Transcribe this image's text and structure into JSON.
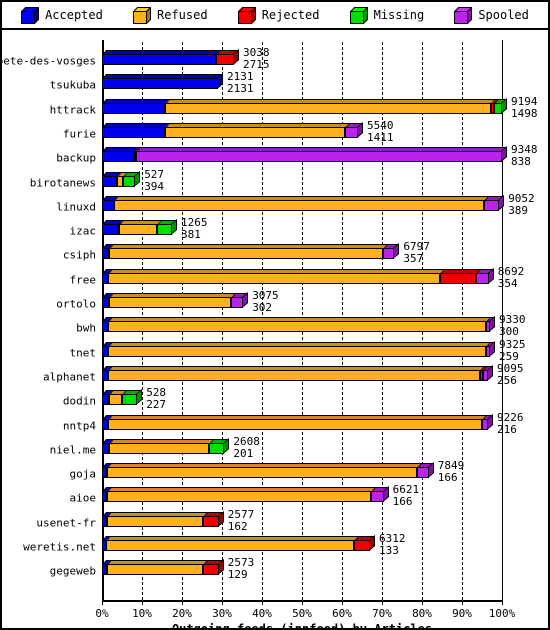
{
  "legend": {
    "items": [
      {
        "label": "Accepted",
        "color": "#0000ee",
        "icon": "cube-icon"
      },
      {
        "label": "Refused",
        "color": "#ffb020",
        "icon": "cube-icon"
      },
      {
        "label": "Rejected",
        "color": "#ee0000",
        "icon": "cube-icon"
      },
      {
        "label": "Missing",
        "color": "#00dd00",
        "icon": "cube-icon"
      },
      {
        "label": "Spooled",
        "color": "#bb22ee",
        "icon": "cube-icon"
      }
    ]
  },
  "chart_data": {
    "type": "bar",
    "orientation": "horizontal",
    "stacked": true,
    "title": "Outgoing feeds (innfeed) by Articles",
    "xlabel": "Outgoing feeds (innfeed) by Articles",
    "ylabel": "",
    "xlim": [
      0,
      100
    ],
    "xunit": "%",
    "grid": true,
    "legend_position": "top",
    "xticks": [
      "0%",
      "10%",
      "20%",
      "30%",
      "40%",
      "50%",
      "60%",
      "70%",
      "80%",
      "90%",
      "100%"
    ],
    "xtick_values": [
      0,
      10,
      20,
      30,
      40,
      50,
      60,
      70,
      80,
      90,
      100
    ],
    "series_names": [
      "Accepted",
      "Refused",
      "Rejected",
      "Missing",
      "Spooled"
    ],
    "series_colors": [
      "#0000ee",
      "#ffb020",
      "#ee0000",
      "#00dd00",
      "#bb22ee"
    ],
    "categories": [
      "bete-des-vosges",
      "tsukuba",
      "httrack",
      "furie",
      "backup",
      "birotanews",
      "linuxd",
      "izac",
      "csiph",
      "free",
      "ortolo",
      "bwh",
      "tnet",
      "alphanet",
      "dodin",
      "nntp4",
      "niel.me",
      "goja",
      "aioe",
      "usenet-fr",
      "weretis.net",
      "gegeweb"
    ],
    "rows": [
      {
        "name": "bete-des-vosges",
        "label_top": "3038",
        "label_bottom": "2715",
        "segments": [
          {
            "series": "Accepted",
            "pct": 28.5
          },
          {
            "series": "Rejected",
            "pct": 4.5
          }
        ]
      },
      {
        "name": "tsukuba",
        "label_top": "2131",
        "label_bottom": "2131",
        "segments": [
          {
            "series": "Accepted",
            "pct": 29.0
          }
        ]
      },
      {
        "name": "httrack",
        "label_top": "9194",
        "label_bottom": "1498",
        "segments": [
          {
            "series": "Accepted",
            "pct": 15.8
          },
          {
            "series": "Refused",
            "pct": 81.5
          },
          {
            "series": "Rejected",
            "pct": 0.8
          },
          {
            "series": "Missing",
            "pct": 1.9
          }
        ]
      },
      {
        "name": "furie",
        "label_top": "5540",
        "label_bottom": "1411",
        "segments": [
          {
            "series": "Accepted",
            "pct": 15.8
          },
          {
            "series": "Refused",
            "pct": 45.0
          },
          {
            "series": "Spooled",
            "pct": 3.2
          }
        ]
      },
      {
        "name": "backup",
        "label_top": "9348",
        "label_bottom": "838",
        "segments": [
          {
            "series": "Accepted",
            "pct": 8.0
          },
          {
            "series": "Rejected",
            "pct": 0.5
          },
          {
            "series": "Spooled",
            "pct": 91.5
          }
        ]
      },
      {
        "name": "birotanews",
        "label_top": "527",
        "label_bottom": "394",
        "segments": [
          {
            "series": "Accepted",
            "pct": 3.8
          },
          {
            "series": "Refused",
            "pct": 1.5
          },
          {
            "series": "Missing",
            "pct": 3.0
          }
        ]
      },
      {
        "name": "linuxd",
        "label_top": "9052",
        "label_bottom": "389",
        "segments": [
          {
            "series": "Accepted",
            "pct": 3.0
          },
          {
            "series": "Refused",
            "pct": 92.5
          },
          {
            "series": "Spooled",
            "pct": 3.8
          }
        ]
      },
      {
        "name": "izac",
        "label_top": "1265",
        "label_bottom": "381",
        "segments": [
          {
            "series": "Accepted",
            "pct": 4.2
          },
          {
            "series": "Refused",
            "pct": 9.5
          },
          {
            "series": "Missing",
            "pct": 3.8
          }
        ]
      },
      {
        "name": "csiph",
        "label_top": "6797",
        "label_bottom": "357",
        "segments": [
          {
            "series": "Accepted",
            "pct": 1.8
          },
          {
            "series": "Refused",
            "pct": 68.5
          },
          {
            "series": "Spooled",
            "pct": 2.8
          }
        ]
      },
      {
        "name": "free",
        "label_top": "8692",
        "label_bottom": "354",
        "segments": [
          {
            "series": "Accepted",
            "pct": 1.5
          },
          {
            "series": "Refused",
            "pct": 83.0
          },
          {
            "series": "Rejected",
            "pct": 9.0
          },
          {
            "series": "Spooled",
            "pct": 3.2
          }
        ]
      },
      {
        "name": "ortolo",
        "label_top": "3075",
        "label_bottom": "302",
        "segments": [
          {
            "series": "Accepted",
            "pct": 1.8
          },
          {
            "series": "Refused",
            "pct": 30.5
          },
          {
            "series": "Spooled",
            "pct": 3.0
          }
        ]
      },
      {
        "name": "bwh",
        "label_top": "9330",
        "label_bottom": "300",
        "segments": [
          {
            "series": "Accepted",
            "pct": 1.5
          },
          {
            "series": "Refused",
            "pct": 94.5
          },
          {
            "series": "Spooled",
            "pct": 1.0
          }
        ]
      },
      {
        "name": "tnet",
        "label_top": "9325",
        "label_bottom": "259",
        "segments": [
          {
            "series": "Accepted",
            "pct": 1.5
          },
          {
            "series": "Refused",
            "pct": 94.5
          },
          {
            "series": "Spooled",
            "pct": 1.0
          }
        ]
      },
      {
        "name": "alphanet",
        "label_top": "9095",
        "label_bottom": "256",
        "segments": [
          {
            "series": "Accepted",
            "pct": 1.5
          },
          {
            "series": "Refused",
            "pct": 93.0
          },
          {
            "series": "Rejected",
            "pct": 0.8
          },
          {
            "series": "Spooled",
            "pct": 1.2
          }
        ]
      },
      {
        "name": "dodin",
        "label_top": "528",
        "label_bottom": "227",
        "segments": [
          {
            "series": "Accepted",
            "pct": 1.8
          },
          {
            "series": "Refused",
            "pct": 3.2
          },
          {
            "series": "Missing",
            "pct": 3.8
          }
        ]
      },
      {
        "name": "nntp4",
        "label_top": "9226",
        "label_bottom": "216",
        "segments": [
          {
            "series": "Accepted",
            "pct": 1.5
          },
          {
            "series": "Refused",
            "pct": 93.5
          },
          {
            "series": "Spooled",
            "pct": 1.5
          }
        ]
      },
      {
        "name": "niel.me",
        "label_top": "2608",
        "label_bottom": "201",
        "segments": [
          {
            "series": "Accepted",
            "pct": 1.8
          },
          {
            "series": "Refused",
            "pct": 25.0
          },
          {
            "series": "Missing",
            "pct": 3.8
          }
        ]
      },
      {
        "name": "goja",
        "label_top": "7849",
        "label_bottom": "166",
        "segments": [
          {
            "series": "Accepted",
            "pct": 1.2
          },
          {
            "series": "Refused",
            "pct": 77.5
          },
          {
            "series": "Spooled",
            "pct": 3.0
          }
        ]
      },
      {
        "name": "aioe",
        "label_top": "6621",
        "label_bottom": "166",
        "segments": [
          {
            "series": "Accepted",
            "pct": 1.2
          },
          {
            "series": "Refused",
            "pct": 66.0
          },
          {
            "series": "Spooled",
            "pct": 3.2
          }
        ]
      },
      {
        "name": "usenet-fr",
        "label_top": "2577",
        "label_bottom": "162",
        "segments": [
          {
            "series": "Accepted",
            "pct": 1.2
          },
          {
            "series": "Refused",
            "pct": 24.0
          },
          {
            "series": "Rejected",
            "pct": 4.0
          }
        ]
      },
      {
        "name": "weretis.net",
        "label_top": "6312",
        "label_bottom": "133",
        "segments": [
          {
            "series": "Accepted",
            "pct": 1.0
          },
          {
            "series": "Refused",
            "pct": 62.0
          },
          {
            "series": "Rejected",
            "pct": 4.0
          }
        ]
      },
      {
        "name": "gegeweb",
        "label_top": "2573",
        "label_bottom": "129",
        "segments": [
          {
            "series": "Accepted",
            "pct": 1.2
          },
          {
            "series": "Refused",
            "pct": 24.0
          },
          {
            "series": "Rejected",
            "pct": 4.0
          }
        ]
      }
    ]
  }
}
